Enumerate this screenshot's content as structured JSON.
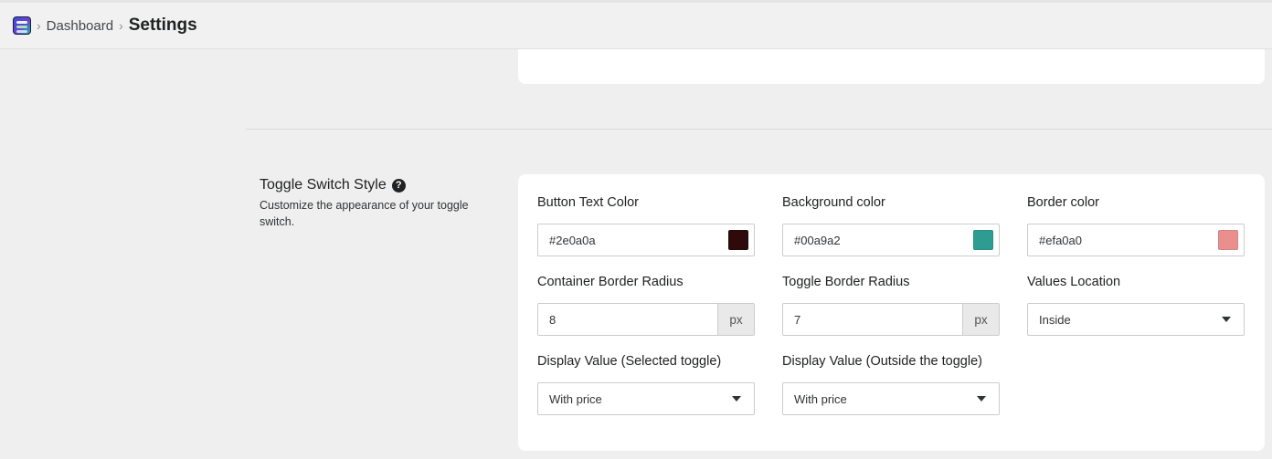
{
  "breadcrumb": {
    "items": [
      "Dashboard",
      "Settings"
    ],
    "separator": "›"
  },
  "section": {
    "title": "Toggle Switch Style",
    "help": "?",
    "description": "Customize the appearance of your toggle switch."
  },
  "fields": {
    "button_text_color": {
      "label": "Button Text Color",
      "value": "#2e0a0a",
      "swatch": "#2e0a0a"
    },
    "background_color": {
      "label": "Background color",
      "value": "#00a9a2",
      "swatch": "#2d9c91"
    },
    "border_color": {
      "label": "Border color",
      "value": "#efa0a0",
      "swatch": "#ea8e8e"
    },
    "container_border_radius": {
      "label": "Container Border Radius",
      "value": "8",
      "suffix": "px"
    },
    "toggle_border_radius": {
      "label": "Toggle Border Radius",
      "value": "7",
      "suffix": "px"
    },
    "values_location": {
      "label": "Values Location",
      "selected": "Inside"
    },
    "display_value_selected": {
      "label": "Display Value (Selected toggle)",
      "selected": "With price"
    },
    "display_value_outside": {
      "label": "Display Value (Outside the toggle)",
      "selected": "With price"
    }
  },
  "icons": {
    "logo": "app-logo-icon",
    "help": "question-circle-icon",
    "dropdown": "caret-down-icon"
  }
}
